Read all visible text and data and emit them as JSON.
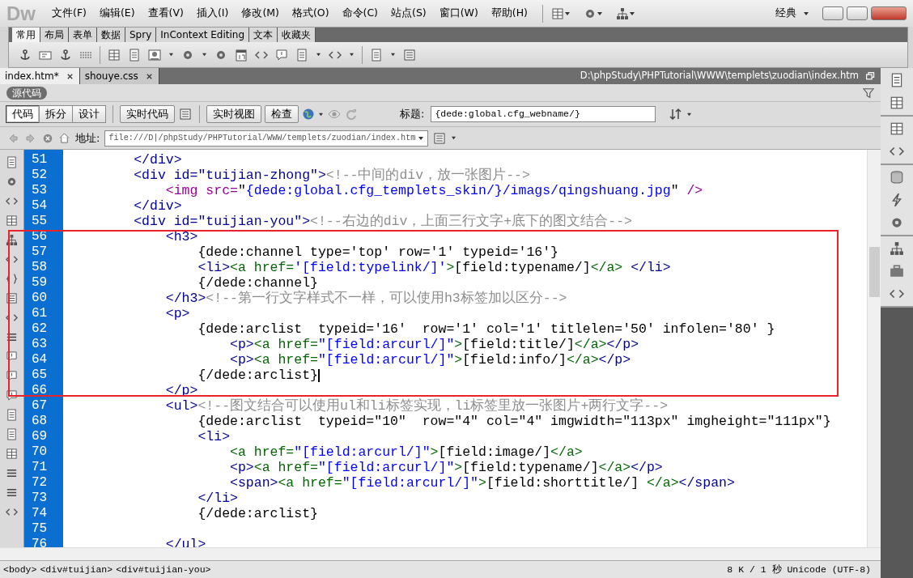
{
  "app": {
    "logo": "Dw",
    "menu": [
      "文件(F)",
      "编辑(E)",
      "查看(V)",
      "插入(I)",
      "修改(M)",
      "格式(O)",
      "命令(C)",
      "站点(S)",
      "窗口(W)",
      "帮助(H)"
    ],
    "workspace": "经典"
  },
  "insert_tabs": [
    {
      "label": "常用",
      "selected": true
    },
    {
      "label": "布局",
      "selected": false
    },
    {
      "label": "表单",
      "selected": false
    },
    {
      "label": "数据",
      "selected": false
    },
    {
      "label": "Spry",
      "selected": false
    },
    {
      "label": "InContext Editing",
      "selected": false
    },
    {
      "label": "文本",
      "selected": false
    },
    {
      "label": "收藏夹",
      "selected": false
    }
  ],
  "doc_tabs": [
    {
      "label": "index.htm*",
      "selected": true
    },
    {
      "label": "shouye.css",
      "selected": false
    }
  ],
  "doc_path": "D:\\phpStudy\\PHPTutorial\\WWW\\templets\\zuodian\\index.htm",
  "source_label": "源代码",
  "view_buttons": [
    {
      "label": "代码",
      "selected": true
    },
    {
      "label": "拆分",
      "selected": false
    },
    {
      "label": "设计",
      "selected": false
    }
  ],
  "live_code_button": "实时代码",
  "live_view_buttons": [
    "实时视图",
    "检查"
  ],
  "title_field": {
    "label": "标题:",
    "value": "{dede:global.cfg_webname/}"
  },
  "address_field": {
    "label": "地址:",
    "value": "file:///D|/phpStudy/PHPTutorial/WWW/templets/zuodian/index.htm"
  },
  "code_lines": [
    {
      "number": "51",
      "segments": [
        {
          "kind": "tag",
          "text": "        </div>"
        }
      ]
    },
    {
      "number": "52",
      "segments": [
        {
          "kind": "tag",
          "text": "        <div id=\"tuijian-zhong\">"
        },
        {
          "kind": "comment",
          "text": "<!--中间的div，放一张图片-->"
        }
      ]
    },
    {
      "number": "53",
      "segments": [
        {
          "kind": "img",
          "text": "            <img src="
        },
        {
          "kind": "text",
          "text": "\""
        },
        {
          "kind": "value",
          "text": "{dede:global.cfg_templets_skin/}/imags/qingshuang.jpg"
        },
        {
          "kind": "text",
          "text": "\" "
        },
        {
          "kind": "img",
          "text": "/>"
        }
      ]
    },
    {
      "number": "54",
      "segments": [
        {
          "kind": "tag",
          "text": "        </div>"
        }
      ]
    },
    {
      "number": "55",
      "segments": [
        {
          "kind": "tag",
          "text": "        <div id=\"tuijian-you\">"
        },
        {
          "kind": "comment",
          "text": "<!--右边的div，上面三行文字+底下的图文结合-->"
        }
      ]
    },
    {
      "number": "56",
      "segments": [
        {
          "kind": "tag",
          "text": "            <h3>"
        }
      ]
    },
    {
      "number": "57",
      "segments": [
        {
          "kind": "text",
          "text": "                {dede:channel type='top' row='1' typeid='16'}"
        }
      ]
    },
    {
      "number": "58",
      "segments": [
        {
          "kind": "tag",
          "text": "                <li>"
        },
        {
          "kind": "link",
          "text": "<a href="
        },
        {
          "kind": "value",
          "text": "'[field:typelink/]'"
        },
        {
          "kind": "link",
          "text": ">"
        },
        {
          "kind": "text",
          "text": "[field:typename/]"
        },
        {
          "kind": "link",
          "text": "</a>"
        },
        {
          "kind": "tag",
          "text": " </li>"
        }
      ]
    },
    {
      "number": "59",
      "segments": [
        {
          "kind": "text",
          "text": "                {/dede:channel}"
        }
      ]
    },
    {
      "number": "60",
      "segments": [
        {
          "kind": "tag",
          "text": "            </h3>"
        },
        {
          "kind": "comment",
          "text": "<!--第一行文字样式不一样，可以使用h3标签加以区分-->"
        }
      ]
    },
    {
      "number": "61",
      "segments": [
        {
          "kind": "tag",
          "text": "            <p>"
        }
      ]
    },
    {
      "number": "62",
      "segments": [
        {
          "kind": "text",
          "text": "                {dede:arclist  typeid='16'  row='1' col='1' titlelen='50' infolen='80' }"
        }
      ]
    },
    {
      "number": "63",
      "segments": [
        {
          "kind": "tag",
          "text": "                    <p>"
        },
        {
          "kind": "link",
          "text": "<a href="
        },
        {
          "kind": "value",
          "text": "\"[field:arcurl/]\""
        },
        {
          "kind": "link",
          "text": ">"
        },
        {
          "kind": "text",
          "text": "[field:title/]"
        },
        {
          "kind": "link",
          "text": "</a>"
        },
        {
          "kind": "tag",
          "text": "</p>"
        }
      ]
    },
    {
      "number": "64",
      "segments": [
        {
          "kind": "tag",
          "text": "                    <p>"
        },
        {
          "kind": "link",
          "text": "<a href="
        },
        {
          "kind": "value",
          "text": "\"[field:arcurl/]\""
        },
        {
          "kind": "link",
          "text": ">"
        },
        {
          "kind": "text",
          "text": "[field:info/]"
        },
        {
          "kind": "link",
          "text": "</a>"
        },
        {
          "kind": "tag",
          "text": "</p>"
        }
      ]
    },
    {
      "number": "65",
      "segments": [
        {
          "kind": "text",
          "text": "                {/dede:arclist}"
        }
      ]
    },
    {
      "number": "66",
      "segments": [
        {
          "kind": "tag",
          "text": "            </p>"
        }
      ]
    },
    {
      "number": "67",
      "segments": [
        {
          "kind": "tag",
          "text": "            <ul>"
        },
        {
          "kind": "comment",
          "text": "<!--图文结合可以使用ul和li标签实现，li标签里放一张图片+两行文字-->"
        }
      ]
    },
    {
      "number": "68",
      "segments": [
        {
          "kind": "text",
          "text": "                {dede:arclist  typeid=\"10\"  row=\"4\" col=\"4\" imgwidth=\"113px\" imgheight=\"111px\"}"
        }
      ]
    },
    {
      "number": "69",
      "segments": [
        {
          "kind": "tag",
          "text": "                <li>"
        }
      ]
    },
    {
      "number": "70",
      "segments": [
        {
          "kind": "link",
          "text": "                    <a href="
        },
        {
          "kind": "value",
          "text": "\"[field:arcurl/]\""
        },
        {
          "kind": "link",
          "text": ">"
        },
        {
          "kind": "text",
          "text": "[field:image/]"
        },
        {
          "kind": "link",
          "text": "</a>"
        }
      ]
    },
    {
      "number": "71",
      "segments": [
        {
          "kind": "tag",
          "text": "                    <p>"
        },
        {
          "kind": "link",
          "text": "<a href="
        },
        {
          "kind": "value",
          "text": "\"[field:arcurl/]\""
        },
        {
          "kind": "link",
          "text": ">"
        },
        {
          "kind": "text",
          "text": "[field:typename/]"
        },
        {
          "kind": "link",
          "text": "</a>"
        },
        {
          "kind": "tag",
          "text": "</p>"
        }
      ]
    },
    {
      "number": "72",
      "segments": [
        {
          "kind": "tag",
          "text": "                    <span>"
        },
        {
          "kind": "link",
          "text": "<a href="
        },
        {
          "kind": "value",
          "text": "\"[field:arcurl/]\""
        },
        {
          "kind": "link",
          "text": ">"
        },
        {
          "kind": "text",
          "text": "[field:shorttitle/] "
        },
        {
          "kind": "link",
          "text": "</a>"
        },
        {
          "kind": "tag",
          "text": "</span>"
        }
      ]
    },
    {
      "number": "73",
      "segments": [
        {
          "kind": "tag",
          "text": "                </li>"
        }
      ]
    },
    {
      "number": "74",
      "segments": [
        {
          "kind": "text",
          "text": "                {/dede:arclist}"
        }
      ]
    },
    {
      "number": "75"
    },
    {
      "number": "76",
      "segments": [
        {
          "kind": "tag",
          "text": "            </ul>"
        }
      ]
    }
  ],
  "status_bar": {
    "tag_path": [
      "<body>",
      "<div#tuijian>",
      "<div#tuijian-you>"
    ],
    "info": "8 K / 1 秒 Unicode (UTF-8)"
  }
}
